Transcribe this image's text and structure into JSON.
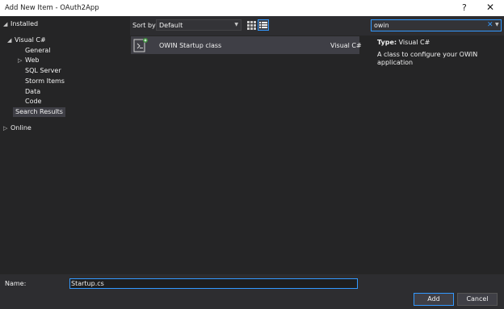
{
  "window": {
    "title": "Add New Item - OAuth2App",
    "help": "?",
    "close": "✕"
  },
  "tree": {
    "installed": "Installed",
    "visual_csharp": "Visual C#",
    "general": "General",
    "web": "Web",
    "sql_server": "SQL Server",
    "storm_items": "Storm Items",
    "data": "Data",
    "code": "Code",
    "search_results": "Search Results",
    "online": "Online"
  },
  "toolbar": {
    "sort_label": "Sort by:",
    "sort_value": "Default"
  },
  "search": {
    "value": "owin"
  },
  "items": [
    {
      "name": "OWIN Startup class",
      "language": "Visual C#"
    }
  ],
  "details": {
    "type_label": "Type:",
    "type_value": "Visual C#",
    "description": "A class to configure your OWIN application"
  },
  "name_field": {
    "label": "Name:",
    "value": "Startup.cs"
  },
  "buttons": {
    "add": "Add",
    "cancel": "Cancel"
  },
  "colors": {
    "accent": "#3399ff",
    "background": "#2d2d30",
    "pane": "#252526"
  }
}
